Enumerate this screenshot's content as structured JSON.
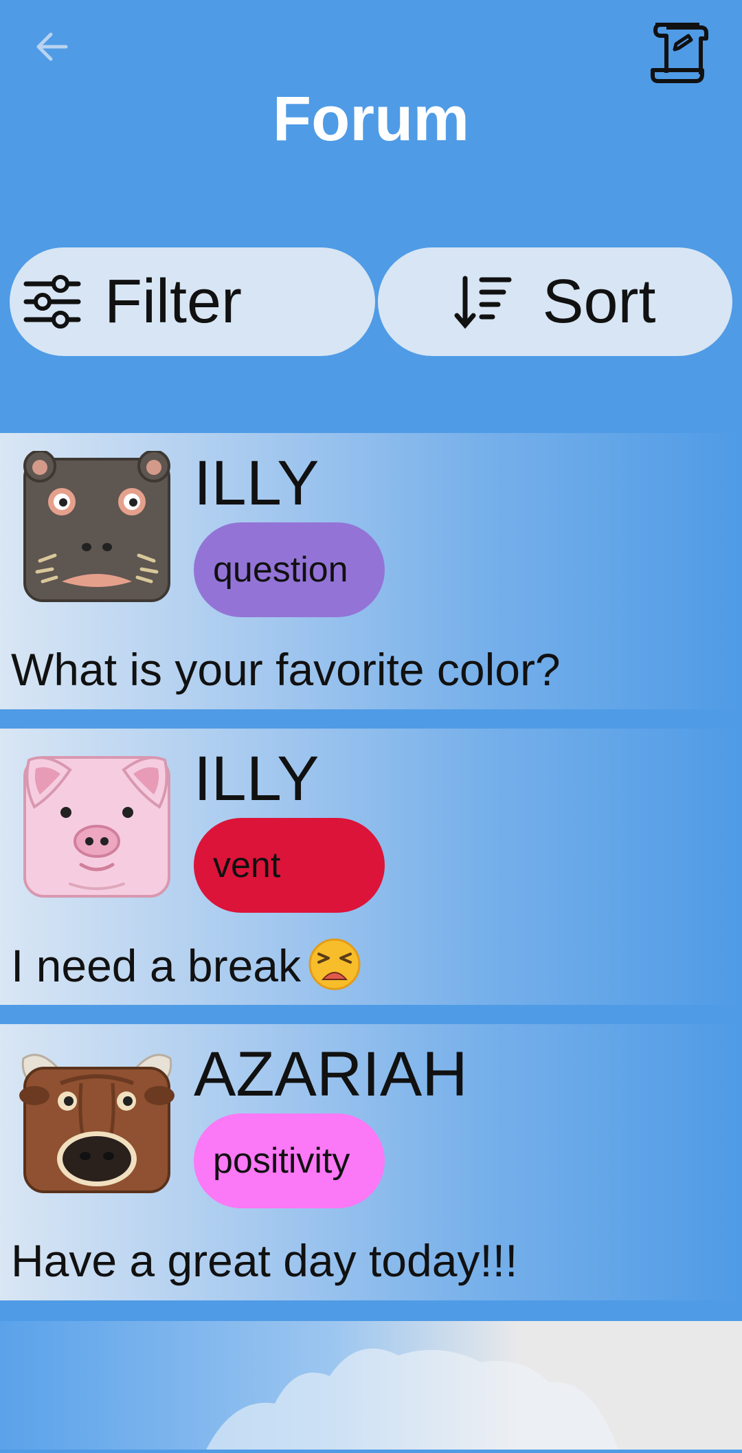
{
  "header": {
    "title": "Forum",
    "back_icon": "arrow-left-icon",
    "scroll_icon": "scroll-icon"
  },
  "toolbar": {
    "filter_label": "Filter",
    "sort_label": "Sort",
    "filter_icon": "sliders-icon",
    "sort_icon": "sort-descending-icon"
  },
  "posts": [
    {
      "user": "ILLY",
      "avatar": "hippo-avatar",
      "tag": "question",
      "tag_color": "#9374d6",
      "message": "What is your favorite color?",
      "emoji": ""
    },
    {
      "user": "ILLY",
      "avatar": "pig-avatar",
      "tag": "vent",
      "tag_color": "#dc1439",
      "message": "I need a break",
      "emoji": "weary-face"
    },
    {
      "user": "AZARIAH",
      "avatar": "bull-avatar",
      "tag": "positivity",
      "tag_color": "#fb78f6",
      "message": "Have a great day today!!!",
      "emoji": ""
    }
  ],
  "colors": {
    "background": "#4f9be6",
    "pill": "#d7e5f4",
    "title": "#ffffff"
  }
}
